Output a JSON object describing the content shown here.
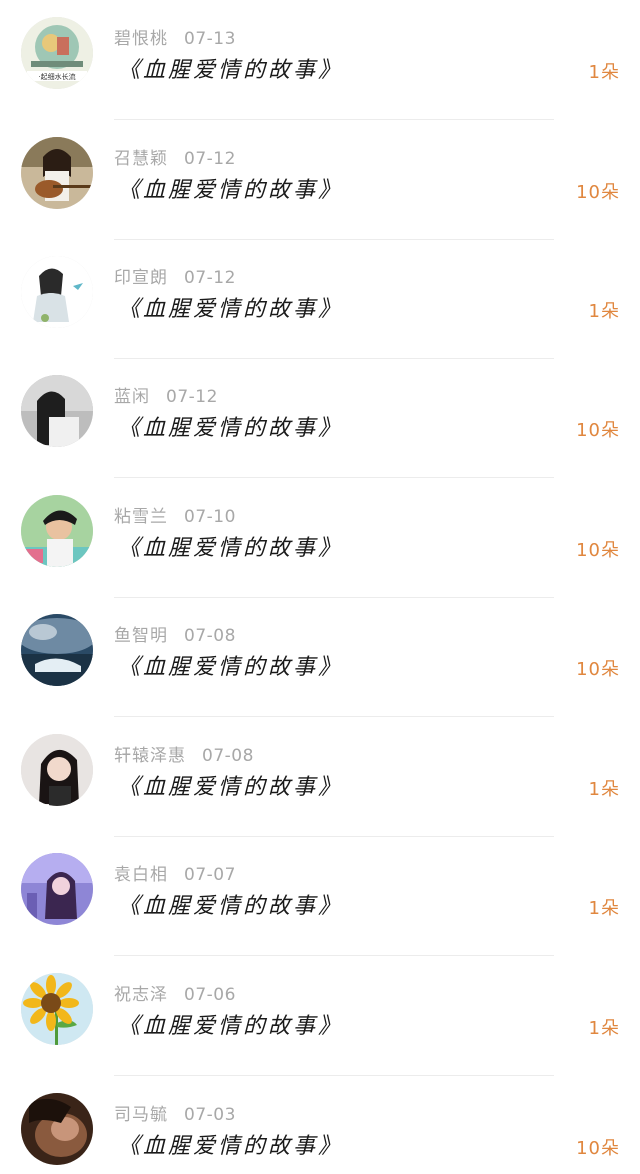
{
  "items": [
    {
      "name": "碧恨桃",
      "date": "07-13",
      "title": "《血腥爱情的故事》",
      "count": "1朵",
      "avatar": "avatar-painting"
    },
    {
      "name": "召慧颖",
      "date": "07-12",
      "title": "《血腥爱情的故事》",
      "count": "10朵",
      "avatar": "avatar-guitar-girl"
    },
    {
      "name": "印宣朗",
      "date": "07-12",
      "title": "《血腥爱情的故事》",
      "count": "1朵",
      "avatar": "avatar-ink-figure"
    },
    {
      "name": "蓝闲",
      "date": "07-12",
      "title": "《血腥爱情的故事》",
      "count": "10朵",
      "avatar": "avatar-bw-girl"
    },
    {
      "name": "粘雪兰",
      "date": "07-10",
      "title": "《血腥爱情的故事》",
      "count": "10朵",
      "avatar": "avatar-boy"
    },
    {
      "name": "鱼智明",
      "date": "07-08",
      "title": "《血腥爱情的故事》",
      "count": "10朵",
      "avatar": "avatar-ocean"
    },
    {
      "name": "轩辕泽惠",
      "date": "07-08",
      "title": "《血腥爱情的故事》",
      "count": "1朵",
      "avatar": "avatar-dark-hair-girl"
    },
    {
      "name": "袁白相",
      "date": "07-07",
      "title": "《血腥爱情的故事》",
      "count": "1朵",
      "avatar": "avatar-purple-girl"
    },
    {
      "name": "祝志泽",
      "date": "07-06",
      "title": "《血腥爱情的故事》",
      "count": "1朵",
      "avatar": "avatar-sunflower"
    },
    {
      "name": "司马毓",
      "date": "07-03",
      "title": "《血腥爱情的故事》",
      "count": "10朵",
      "avatar": "avatar-sepia"
    }
  ],
  "colors": {
    "accent": "#e0873f",
    "meta": "#a8a8a8",
    "title": "#1a1a1a",
    "divider": "#ececec"
  }
}
